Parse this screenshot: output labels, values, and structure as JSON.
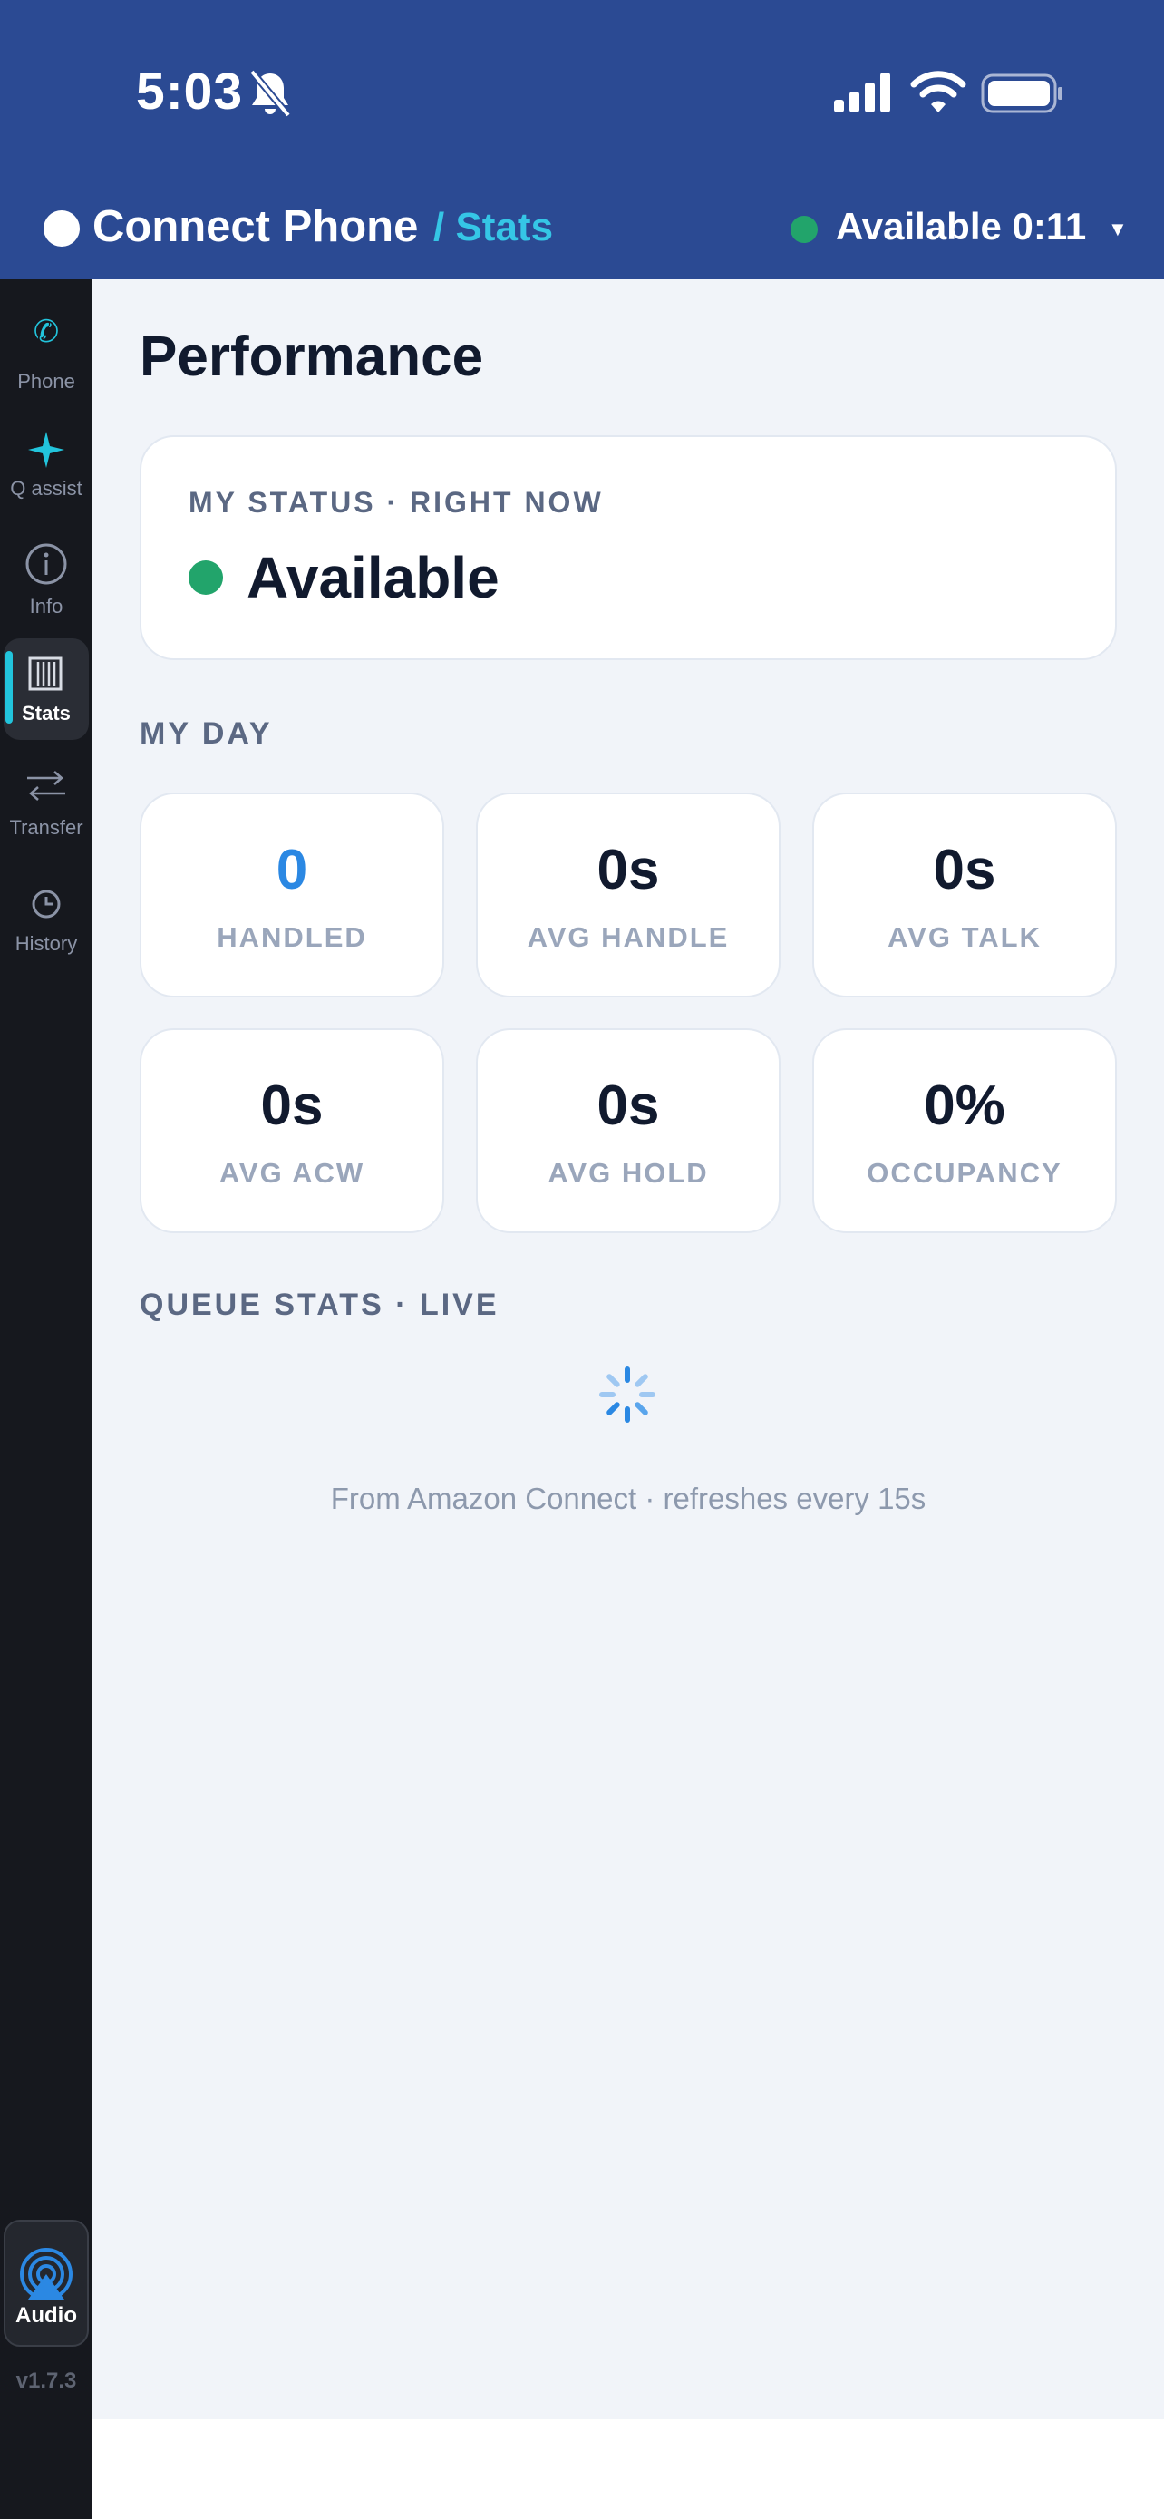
{
  "status_bar": {
    "time": "5:03",
    "icons": [
      "bell-slash-icon",
      "cellular-signal-icon",
      "wifi-icon",
      "battery-icon"
    ]
  },
  "header": {
    "app_name": "Connect Phone",
    "section": "/ Stats",
    "agent_status": "Available 0:11",
    "status_color": "#22a46b"
  },
  "sidebar": {
    "items": [
      {
        "label": "Phone",
        "icon": "phone-icon"
      },
      {
        "label": "Q assist",
        "icon": "sparkle-icon"
      },
      {
        "label": "Info",
        "icon": "info-icon"
      },
      {
        "label": "Stats",
        "icon": "stats-bars-icon",
        "active": true
      },
      {
        "label": "Transfer",
        "icon": "transfer-arrows-icon"
      },
      {
        "label": "History",
        "icon": "clock-icon"
      }
    ],
    "audio_label": "Audio",
    "version": "v1.7.3"
  },
  "main": {
    "title": "Performance",
    "status_card": {
      "label": "MY STATUS · RIGHT NOW",
      "value": "Available"
    },
    "my_day_label": "MY DAY",
    "stats": [
      {
        "value": "0",
        "label": "HANDLED"
      },
      {
        "value": "0s",
        "label": "AVG HANDLE"
      },
      {
        "value": "0s",
        "label": "AVG TALK"
      },
      {
        "value": "0s",
        "label": "AVG ACW"
      },
      {
        "value": "0s",
        "label": "AVG HOLD"
      },
      {
        "value": "0%",
        "label": "OCCUPANCY"
      }
    ],
    "queue_label": "QUEUE STATS · LIVE",
    "footnote": "From Amazon Connect · refreshes every 15s"
  },
  "colors": {
    "header_bg": "#2b4a93",
    "accent_cyan": "#22c4dc",
    "accent_blue": "#2b88e3",
    "available_green": "#22a46b"
  }
}
